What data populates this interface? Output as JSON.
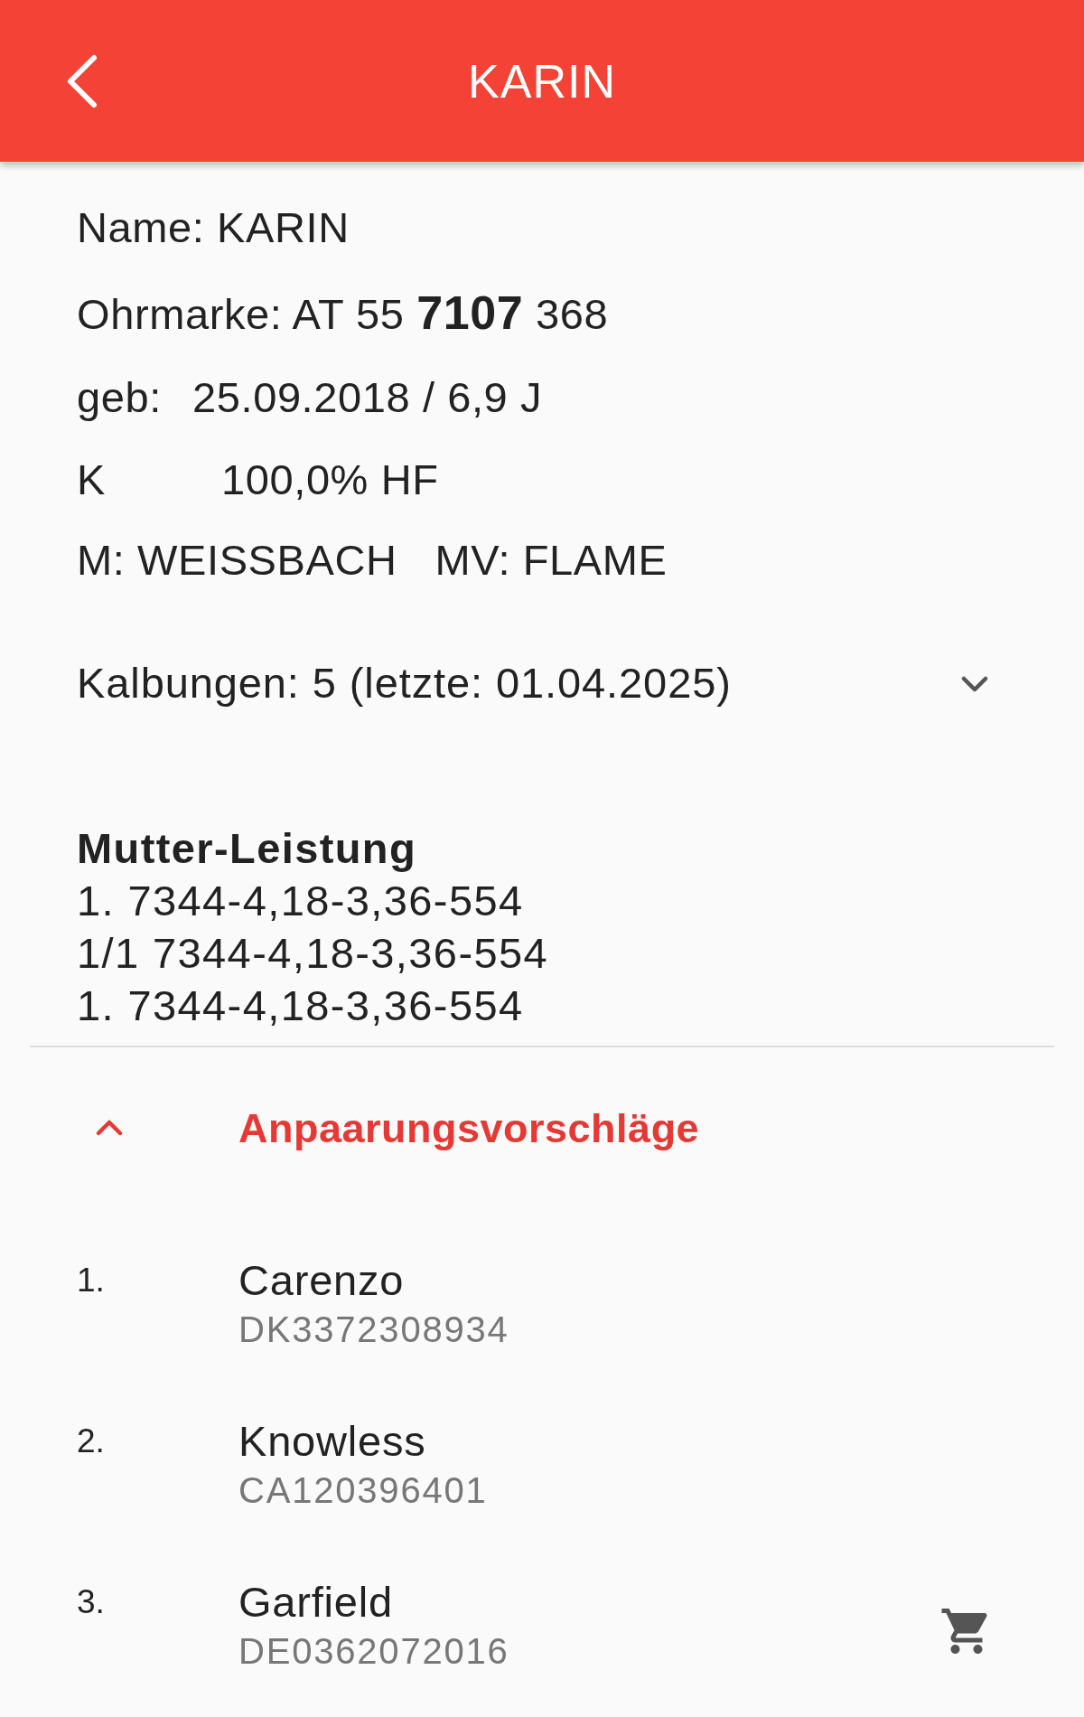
{
  "app_bar": {
    "title": "KARIN"
  },
  "animal": {
    "name_line": "Name: KARIN",
    "ear_tag": "Ohrmarke: AT 55 **7107** 368",
    "birth_label": "geb:",
    "birth_value": "25.09.2018 / 6,9 J",
    "breed_code": "K",
    "breed_share": "100,0% HF",
    "mother": "M: WEISSBACH",
    "maternal_sire": "MV: FLAME"
  },
  "calvings": {
    "text": "Kalbungen: 5 (letzte: 01.04.2025)",
    "expanded": false
  },
  "mother_performance": {
    "title": "Mutter-Leistung",
    "lines": [
      "1. 7344-4,18-3,36-554",
      "1/1 7344-4,18-3,36-554",
      "1. 7344-4,18-3,36-554"
    ]
  },
  "mating_suggestions": {
    "title": "Anpaarungsvorschläge",
    "expanded": true,
    "items": [
      {
        "rank": "1.",
        "name": "Carenzo",
        "code": "DK3372308934",
        "cart": false
      },
      {
        "rank": "2.",
        "name": "Knowless",
        "code": "CA120396401",
        "cart": false
      },
      {
        "rank": "3.",
        "name": "Garfield",
        "code": "DE0362072016",
        "cart": true
      }
    ]
  }
}
